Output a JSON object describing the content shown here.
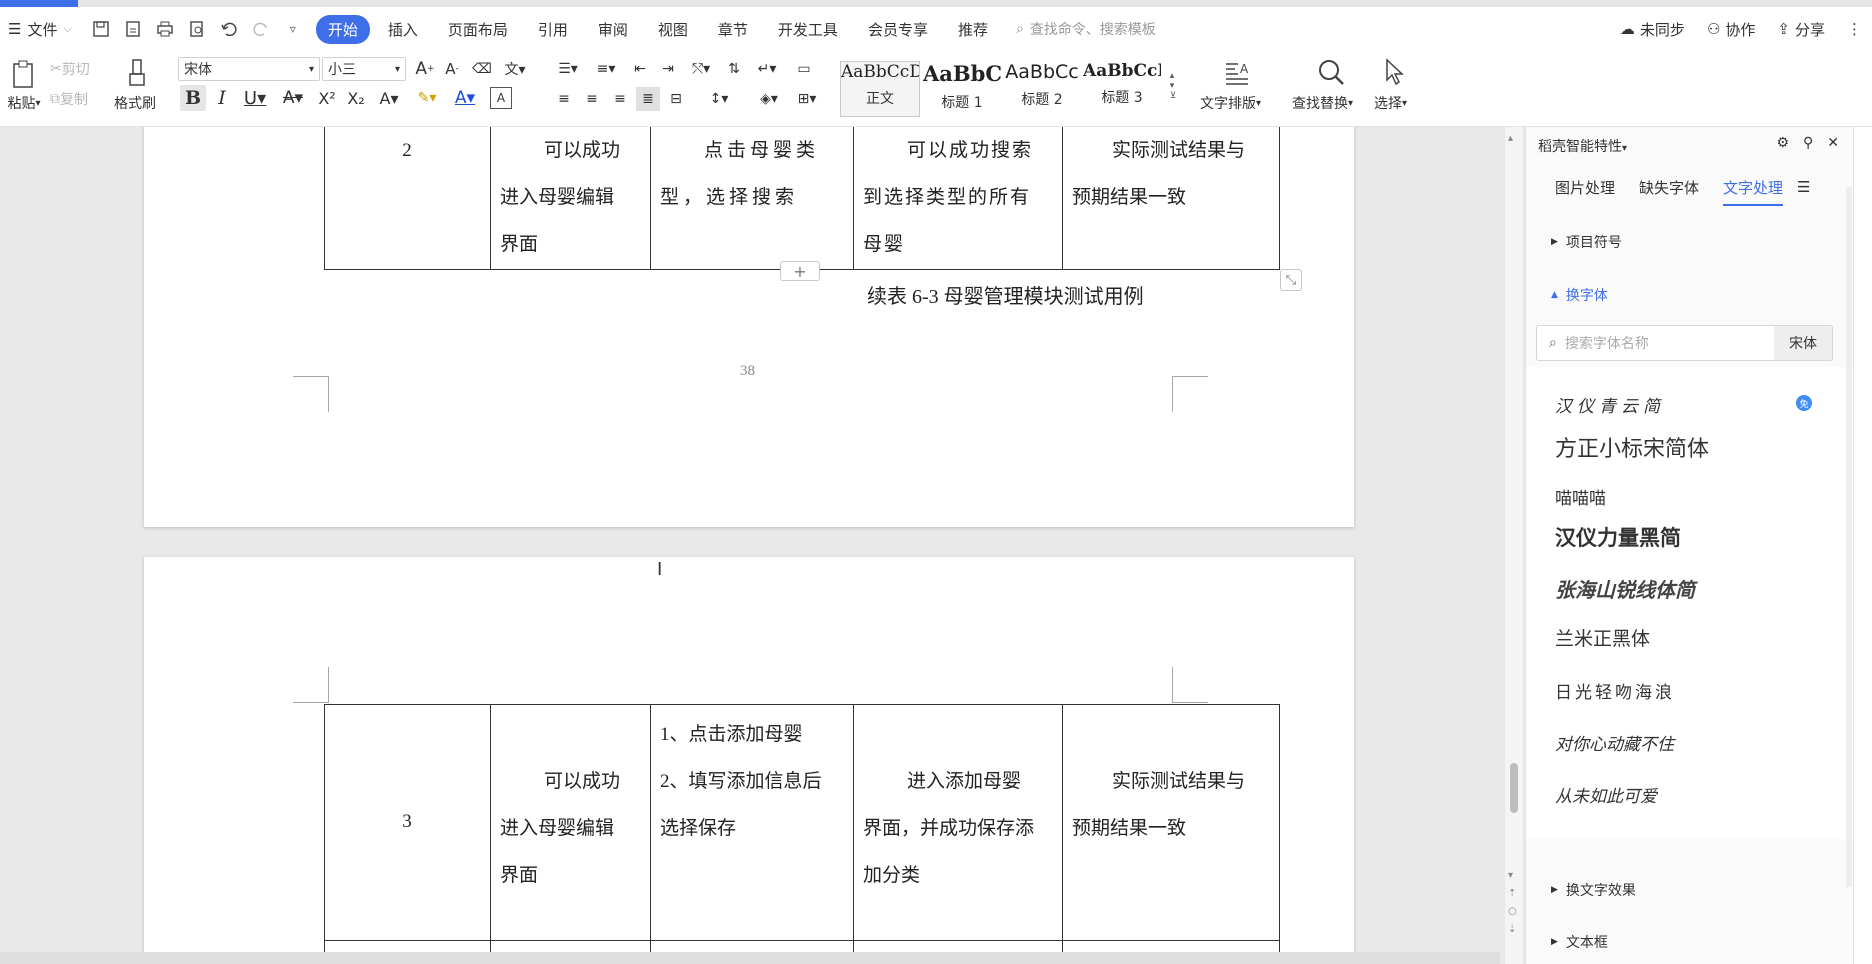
{
  "menubar": {
    "file_label": "文件",
    "tabs": [
      "开始",
      "插入",
      "页面布局",
      "引用",
      "审阅",
      "视图",
      "章节",
      "开发工具",
      "会员专享",
      "推荐"
    ],
    "active_tab": "开始",
    "search_placeholder": "查找命令、搜索模板",
    "right": {
      "sync": "未同步",
      "collab": "协作",
      "share": "分享"
    }
  },
  "ribbon": {
    "paste": "粘贴",
    "cut": "剪切",
    "copy": "复制",
    "format_painter": "格式刷",
    "font_name": "宋体",
    "font_size": "小三",
    "styles": [
      {
        "preview": "AaBbCcDd",
        "name": "正文"
      },
      {
        "preview": "AaBbC",
        "name": "标题 1"
      },
      {
        "preview": "AaBbCc",
        "name": "标题 2"
      },
      {
        "preview": "AaBbCcI",
        "name": "标题 3"
      }
    ],
    "text_layout": "文字排版",
    "find_replace": "查找替换",
    "select": "选择"
  },
  "document": {
    "page1": {
      "row": [
        "2",
        "可以成功\n进入母婴编辑\n界面",
        "点击母婴类\n型，选择搜索",
        "可以成功搜索\n到选择类型的所有\n母婴",
        "实际测试结果与\n预期结果一致"
      ],
      "caption": "续表 6-3  母婴管理模块测试用例",
      "page_number": "38"
    },
    "page2": {
      "row": [
        "3",
        "可以成功\n进入母婴编辑\n界面",
        "1、点击添加母婴\n2、填写添加信息后\n选择保存",
        "进入添加母婴\n界面，并成功保存添\n加分类",
        "实际测试结果与\n预期结果一致"
      ]
    }
  },
  "panel": {
    "title": "稻壳智能特性",
    "tabs": [
      "图片处理",
      "缺失字体",
      "文字处理"
    ],
    "active_tab": "文字处理",
    "sections": {
      "bullets": "项目符号",
      "change_font": "换字体",
      "text_effect": "换文字效果",
      "text_box": "文本框"
    },
    "font_search_placeholder": "搜索字体名称",
    "current_font": "宋体",
    "fonts": [
      "汉仪青云简",
      "方正小标宋简体",
      "喵喵喵",
      "汉仪力量黑简",
      "张海山锐线体简",
      "兰米正黑体",
      "日光轻吻海浪",
      "对你心动藏不住",
      "从未如此可爱"
    ]
  }
}
